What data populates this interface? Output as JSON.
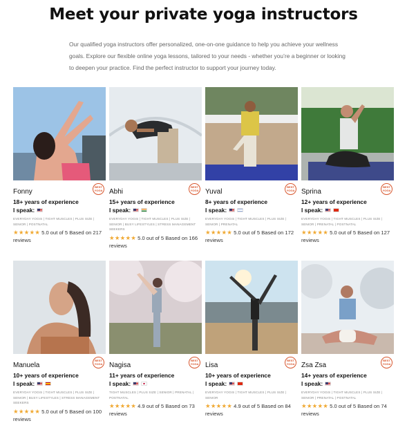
{
  "page": {
    "title": "Meet your private yoga instructors",
    "intro": "Our qualified yoga instructors offer personalized, one-on-one guidance to help you achieve your wellness goals. Explore our flexible online yoga lessons, tailored to your needs - whether you’re a beginner or looking to deepen your practice. Find the perfect instructor to support your journey today."
  },
  "badge_text": "BEST YOGA",
  "colors": {
    "star": "#f0a933",
    "badge": "#d8562d"
  },
  "instructors": [
    {
      "name": "Fonny",
      "experience": "18+ years of experience",
      "speak_label": "I speak:",
      "flags": [
        "us-flag"
      ],
      "tags": "EVERYDAY YOGIS | TIGHT MUSCLES | PLUS SIZE | SENIOR | POSTNATAL",
      "stars": "★★★★★",
      "rating": "5.0 out of 5 Based on 217 reviews"
    },
    {
      "name": "Abhi",
      "experience": "15+ years of experience",
      "speak_label": "I speak:",
      "flags": [
        "us-flag",
        "in-flag"
      ],
      "tags": "EVERYDAY YOGIS | TIGHT MUSCLES | PLUS SIZE | SENIOR | BUSY LIFESTYLES | STRESS MANAGEMENT SEEKERS",
      "stars": "★★★★★",
      "rating": "5.0 out of 5 Based on 166 reviews"
    },
    {
      "name": "Yuval",
      "experience": "8+ years of experience",
      "speak_label": "I speak:",
      "flags": [
        "us-flag",
        "il-flag"
      ],
      "tags": "EVERYDAY YOGIS | TIGHT MUSCLES | PLUS SIZE | SENIOR | PRENATAL",
      "stars": "★★★★★",
      "rating": "5.0 out of 5 Based on 172 reviews"
    },
    {
      "name": "Sprina",
      "experience": "12+ years of experience",
      "speak_label": "I speak:",
      "flags": [
        "us-flag",
        "cn-flag"
      ],
      "tags": "EVERYDAY YOGIS | TIGHT MUSCLES | PLUS SIZE | SENIOR | PRENATAL | POSTNATAL",
      "stars": "★★★★★",
      "rating": "5.0 out of 5 Based on 127 reviews"
    },
    {
      "name": "Manuela",
      "experience": "10+ years of experience",
      "speak_label": "I speak:",
      "flags": [
        "us-flag",
        "es-flag"
      ],
      "tags": "EVERYDAY YOGIS | TIGHT MUSCLES | PLUS SIZE | SENIOR | BUSY LIFESTYLES | STRESS MANAGEMENT SEEKERS",
      "stars": "★★★★★",
      "rating": "5.0 out of 5 Based on 100 reviews"
    },
    {
      "name": "Nagisa",
      "experience": "11+ years of experience",
      "speak_label": "I speak:",
      "flags": [
        "us-flag",
        "jp-flag"
      ],
      "tags": "TIGHT MUSCLES | PLUS SIZE | SENIOR | PRENATAL | POSTNATAL",
      "stars": "★★★★★",
      "rating": "4.9 out of 5 Based on 73 reviews"
    },
    {
      "name": "Lisa",
      "experience": "10+ years of experience",
      "speak_label": "I speak:",
      "flags": [
        "us-flag",
        "cn-flag"
      ],
      "tags": "EVERYDAY YOGIS | TIGHT MUSCLES | PLUS SIZE | SENIOR",
      "stars": "★★★★★",
      "rating": "4.9 out of 5 Based on 84 reviews"
    },
    {
      "name": "Zsa Zsa",
      "experience": "14+ years of experience",
      "speak_label": "I speak:",
      "flags": [
        "us-flag"
      ],
      "tags": "EVERYDAY YOGIS | TIGHT MUSCLES | PLUS SIZE | SENIOR | PRENATAL | POSTNATAL",
      "stars": "★★★★★",
      "rating": "5.0 out of 5 Based on 74 reviews"
    }
  ]
}
